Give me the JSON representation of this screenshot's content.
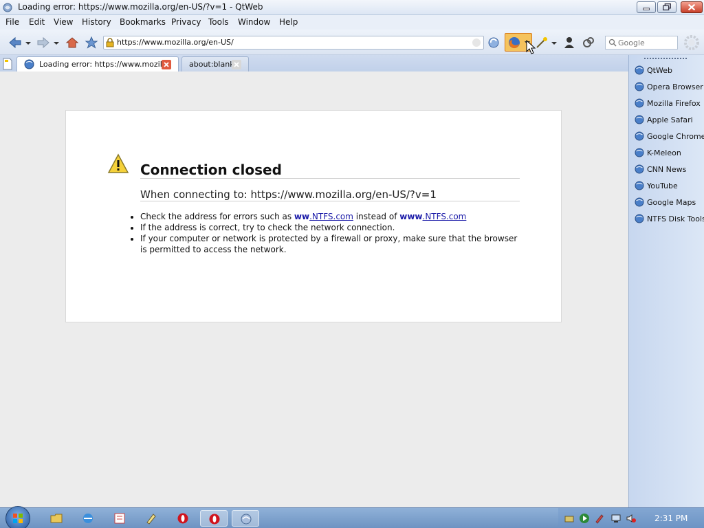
{
  "window": {
    "title": "Loading error: https://www.mozilla.org/en-US/?v=1 - QtWeb"
  },
  "menu": [
    "File",
    "Edit",
    "View",
    "History",
    "Bookmarks",
    "Privacy",
    "Tools",
    "Window",
    "Help"
  ],
  "toolbar": {
    "url": "https://www.mozilla.org/en-US/",
    "search_placeholder": "Google"
  },
  "tabs": [
    {
      "label": "Loading error: https://www.mozill...",
      "active": true
    },
    {
      "label": "about:blank",
      "active": false
    }
  ],
  "error": {
    "title": "Connection closed",
    "subtitle": "When connecting to: https://www.mozilla.org/en-US/?v=1",
    "tip1_prefix": "Check the address for errors such as ",
    "tip1_bad_bold": "ww",
    "tip1_bad_link": ".NTFS.com",
    "tip1_mid": " instead of ",
    "tip1_good_bold": "www",
    "tip1_good_link": ".NTFS.com",
    "tip2": "If the address is correct, try to check the network connection.",
    "tip3": "If your computer or network is protected by a firewall or proxy, make sure that the browser is permitted to access the network."
  },
  "bookmarks": [
    "QtWeb",
    "Opera Browser",
    "Mozilla Firefox",
    "Apple Safari",
    "Google Chrome",
    "K-Meleon",
    "CNN News",
    "YouTube",
    "Google Maps",
    "NTFS Disk Tools"
  ],
  "taskbar": {
    "clock": "2:31 PM"
  },
  "colors": {
    "link": "#1a1aa8",
    "close_button": "#c8402a",
    "firefox_highlight": "#f5c35d"
  }
}
